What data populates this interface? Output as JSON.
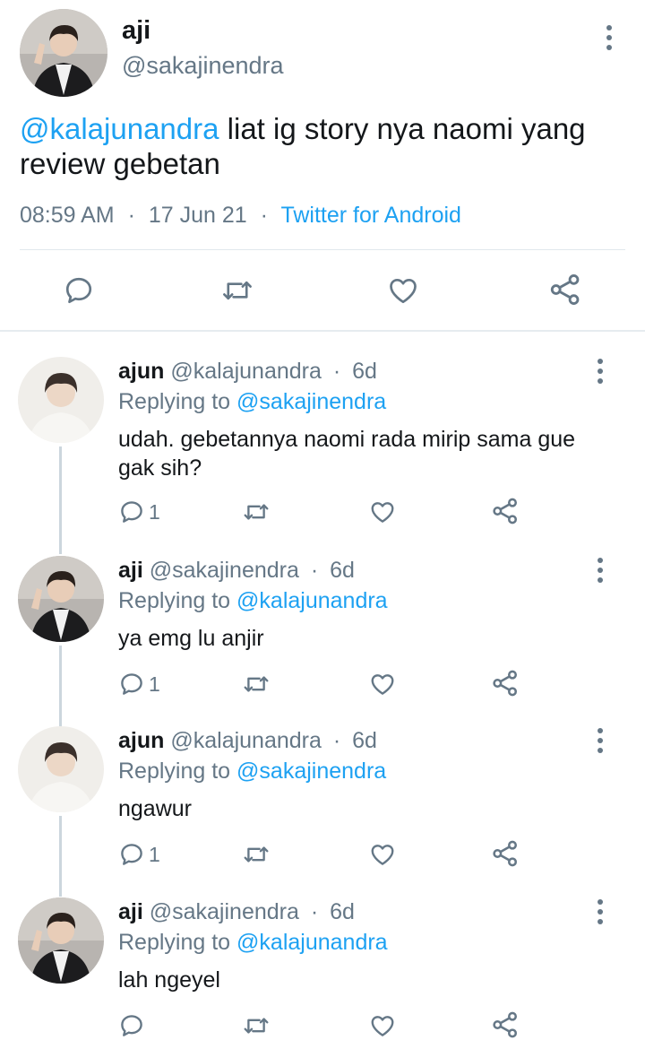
{
  "main_tweet": {
    "name": "aji",
    "handle": "@sakajinendra",
    "text_mention": "@kalajunandra",
    "text_body": " liat ig story nya naomi yang review gebetan",
    "time": "08:59 AM",
    "date": "17 Jun 21",
    "separator": "·",
    "source": "Twitter for Android",
    "icons": [
      "reply-icon",
      "retweet-icon",
      "like-icon",
      "share-icon"
    ]
  },
  "replies": [
    {
      "name": "ajun",
      "handle": "@kalajunandra",
      "separator": "·",
      "age": "6d",
      "replying_prefix": "Replying to ",
      "replying_to": "@sakajinendra",
      "text": "udah. gebetannya naomi rada mirip sama gue gak sih?",
      "reply_count": "1"
    },
    {
      "name": "aji",
      "handle": "@sakajinendra",
      "separator": "·",
      "age": "6d",
      "replying_prefix": "Replying to ",
      "replying_to": "@kalajunandra",
      "text": "ya emg lu anjir",
      "reply_count": "1"
    },
    {
      "name": "ajun",
      "handle": "@kalajunandra",
      "separator": "·",
      "age": "6d",
      "replying_prefix": "Replying to ",
      "replying_to": "@sakajinendra",
      "text": "ngawur",
      "reply_count": "1"
    },
    {
      "name": "aji",
      "handle": "@sakajinendra",
      "separator": "·",
      "age": "6d",
      "replying_prefix": "Replying to ",
      "replying_to": "@kalajunandra",
      "text": "lah ngeyel",
      "reply_count": ""
    }
  ],
  "colors": {
    "accent": "#1da1f2",
    "secondary_text": "#657786",
    "divider": "#e1e8ed"
  }
}
